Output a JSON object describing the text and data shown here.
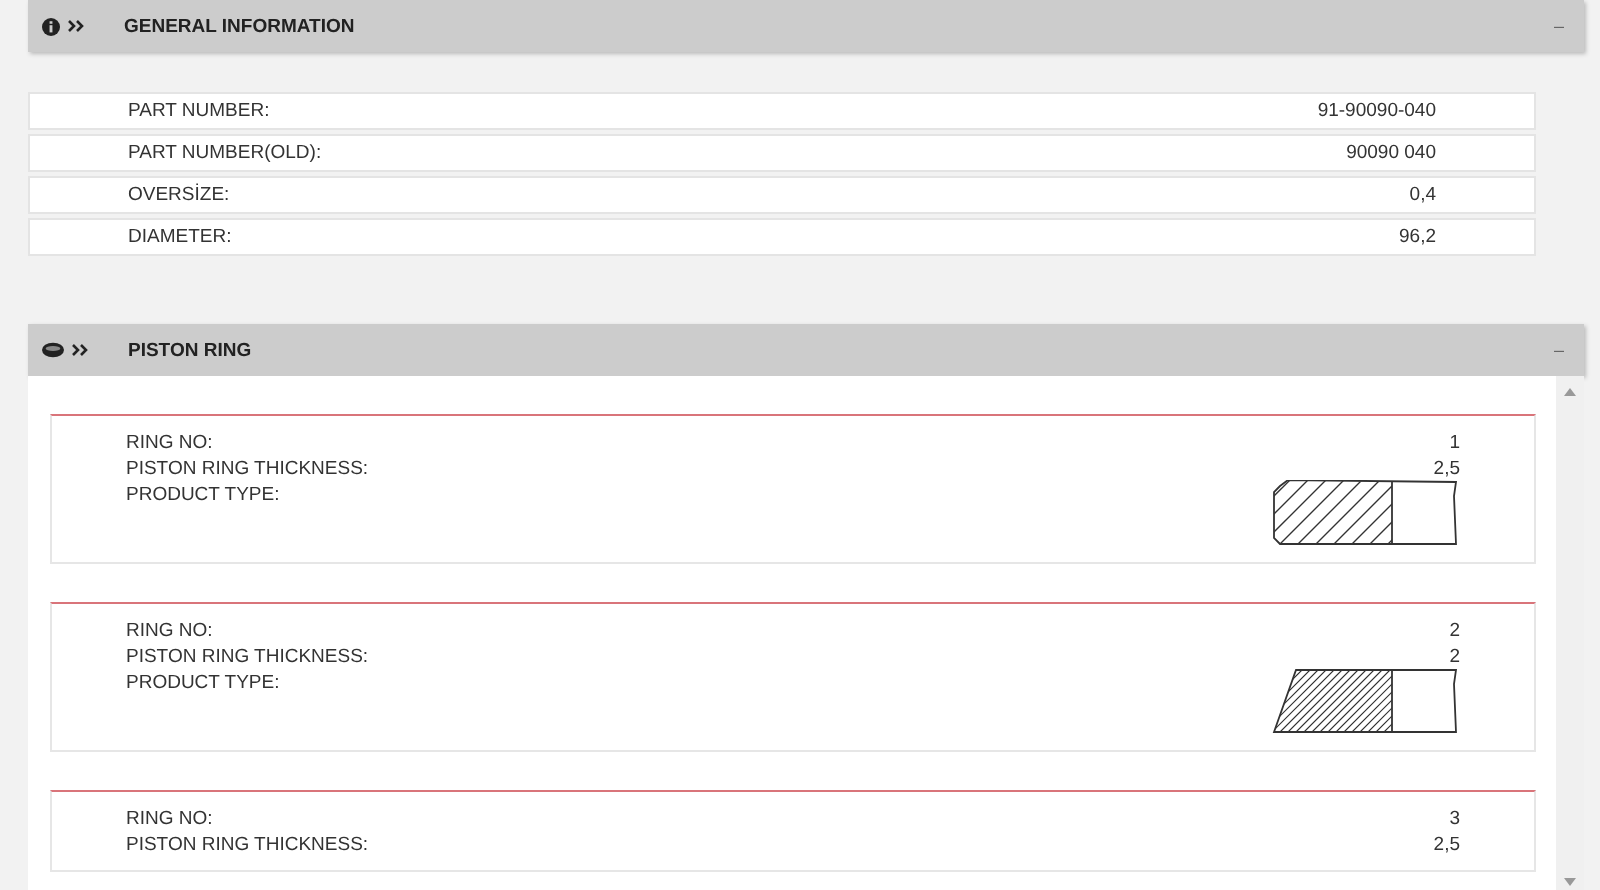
{
  "sections": [
    {
      "kind": "info",
      "title": "GENERAL INFORMATION",
      "toggle": "–",
      "rows": [
        {
          "label": "PART NUMBER:",
          "value": "91-90090-040"
        },
        {
          "label": "PART NUMBER(OLD):",
          "value": "90090 040"
        },
        {
          "label": "OVERSİZE:",
          "value": "0,4"
        },
        {
          "label": "DIAMETER:",
          "value": "96,2"
        }
      ]
    },
    {
      "kind": "rings",
      "title": "PISTON RING",
      "toggle": "–",
      "rings": [
        {
          "fields": [
            {
              "kind": "text",
              "label": "RING NO:",
              "value": "1"
            },
            {
              "kind": "text",
              "label": "PISTON RING THICKNESS:",
              "value": "2,5"
            },
            {
              "kind": "barrel",
              "label": "PRODUCT TYPE:"
            }
          ]
        },
        {
          "fields": [
            {
              "kind": "text",
              "label": "RING NO:",
              "value": "2"
            },
            {
              "kind": "text",
              "label": "PISTON RING THICKNESS:",
              "value": "2"
            },
            {
              "kind": "taper",
              "label": "PRODUCT TYPE:"
            }
          ]
        },
        {
          "fields": [
            {
              "kind": "text",
              "label": "RING NO:",
              "value": "3"
            },
            {
              "kind": "text",
              "label": "PISTON RING THICKNESS:",
              "value": "2,5"
            }
          ]
        }
      ]
    }
  ]
}
